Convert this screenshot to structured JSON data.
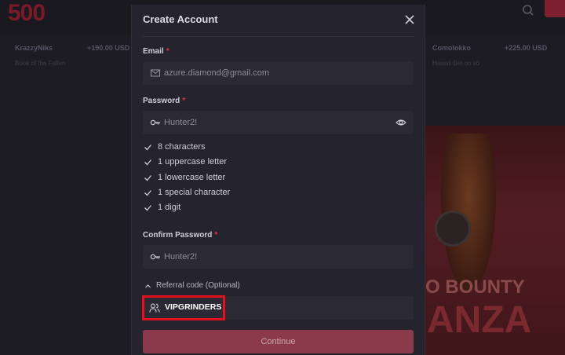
{
  "background": {
    "logo": "500",
    "winners": [
      {
        "name": "KrazzyNiks",
        "amount": "+190.00 USD",
        "sub": "Book of the Fallen"
      },
      {
        "name": "Comolokko",
        "amount": "+225.00 USD",
        "sub": "Hawaii Bet on x6"
      }
    ],
    "promo_line1": "O BOUNTY",
    "promo_line2": "ANZA",
    "colors": {
      "page": "#1d1c24",
      "accent": "#7d2030"
    }
  },
  "modal": {
    "title": "Create Account",
    "email": {
      "label": "Email",
      "required_mark": "*",
      "value": "azure.diamond@gmail.com"
    },
    "password": {
      "label": "Password",
      "required_mark": "*",
      "value": "Hunter2!"
    },
    "requirements": [
      {
        "text": "8 characters"
      },
      {
        "text": "1 uppercase letter"
      },
      {
        "text": "1 lowercase letter"
      },
      {
        "text": "1 special character"
      },
      {
        "text": "1 digit"
      }
    ],
    "confirm_password": {
      "label": "Confirm Password",
      "required_mark": "*",
      "value": "Hunter2!"
    },
    "referral": {
      "toggle_label": "Referral code (Optional)",
      "value": "VIPGRINDERS"
    },
    "continue_label": "Continue",
    "colors": {
      "modal_bg": "#25232d",
      "input_bg": "#2b2934",
      "required": "#e0354b",
      "button": "#8a3a4a",
      "highlight": "#e3101e"
    }
  }
}
